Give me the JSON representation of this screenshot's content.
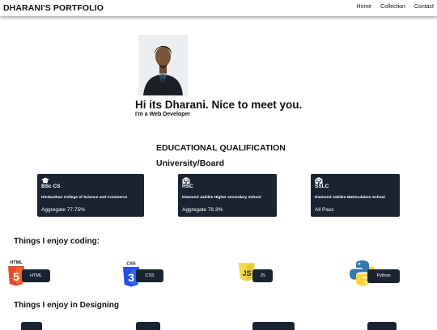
{
  "nav": {
    "brand": "DHARANI'S PORTFOLIO",
    "links": [
      "Home",
      "Collection",
      "Contact"
    ]
  },
  "hero": {
    "greeting": "Hi its Dharani. Nice to meet you.",
    "role": "I'm a Web Developer"
  },
  "education": {
    "title": "EDUCATIONAL QUALIFICATION",
    "subtitle": "University/Board",
    "cards": [
      {
        "icon": "graduation-cap-icon",
        "degree": "BSc CS",
        "institution": "Hindusthan College of Science and Commerce",
        "aggregate": "Aggregate 77.75%"
      },
      {
        "icon": "school-building-icon",
        "degree": "HSC",
        "institution": "Diamond Jubilee Higher secondary School",
        "aggregate": "Aggregate 78.3%"
      },
      {
        "icon": "school-building-icon",
        "degree": "SSLC",
        "institution": "Diamond Jubilee Matriculation School",
        "aggregate": "All Pass"
      }
    ]
  },
  "coding": {
    "title": "Things I enjoy coding:",
    "items": [
      {
        "icon": "html5-logo-icon",
        "icon_text": "HTML",
        "label": "HTML"
      },
      {
        "icon": "css3-logo-icon",
        "icon_text": "CSS",
        "label": "CSS"
      },
      {
        "icon": "js-logo-icon",
        "icon_text": "JS",
        "label": "JS"
      },
      {
        "icon": "python-logo-icon",
        "label": "Python"
      }
    ]
  },
  "designing": {
    "title": "Things I enjoy in Designing"
  },
  "colors": {
    "card_bg": "#1a2332",
    "html_orange": "#e44d26",
    "css_blue": "#264de4",
    "js_yellow": "#f0db4f",
    "python_blue": "#3776ab",
    "python_yellow": "#ffd43b"
  }
}
